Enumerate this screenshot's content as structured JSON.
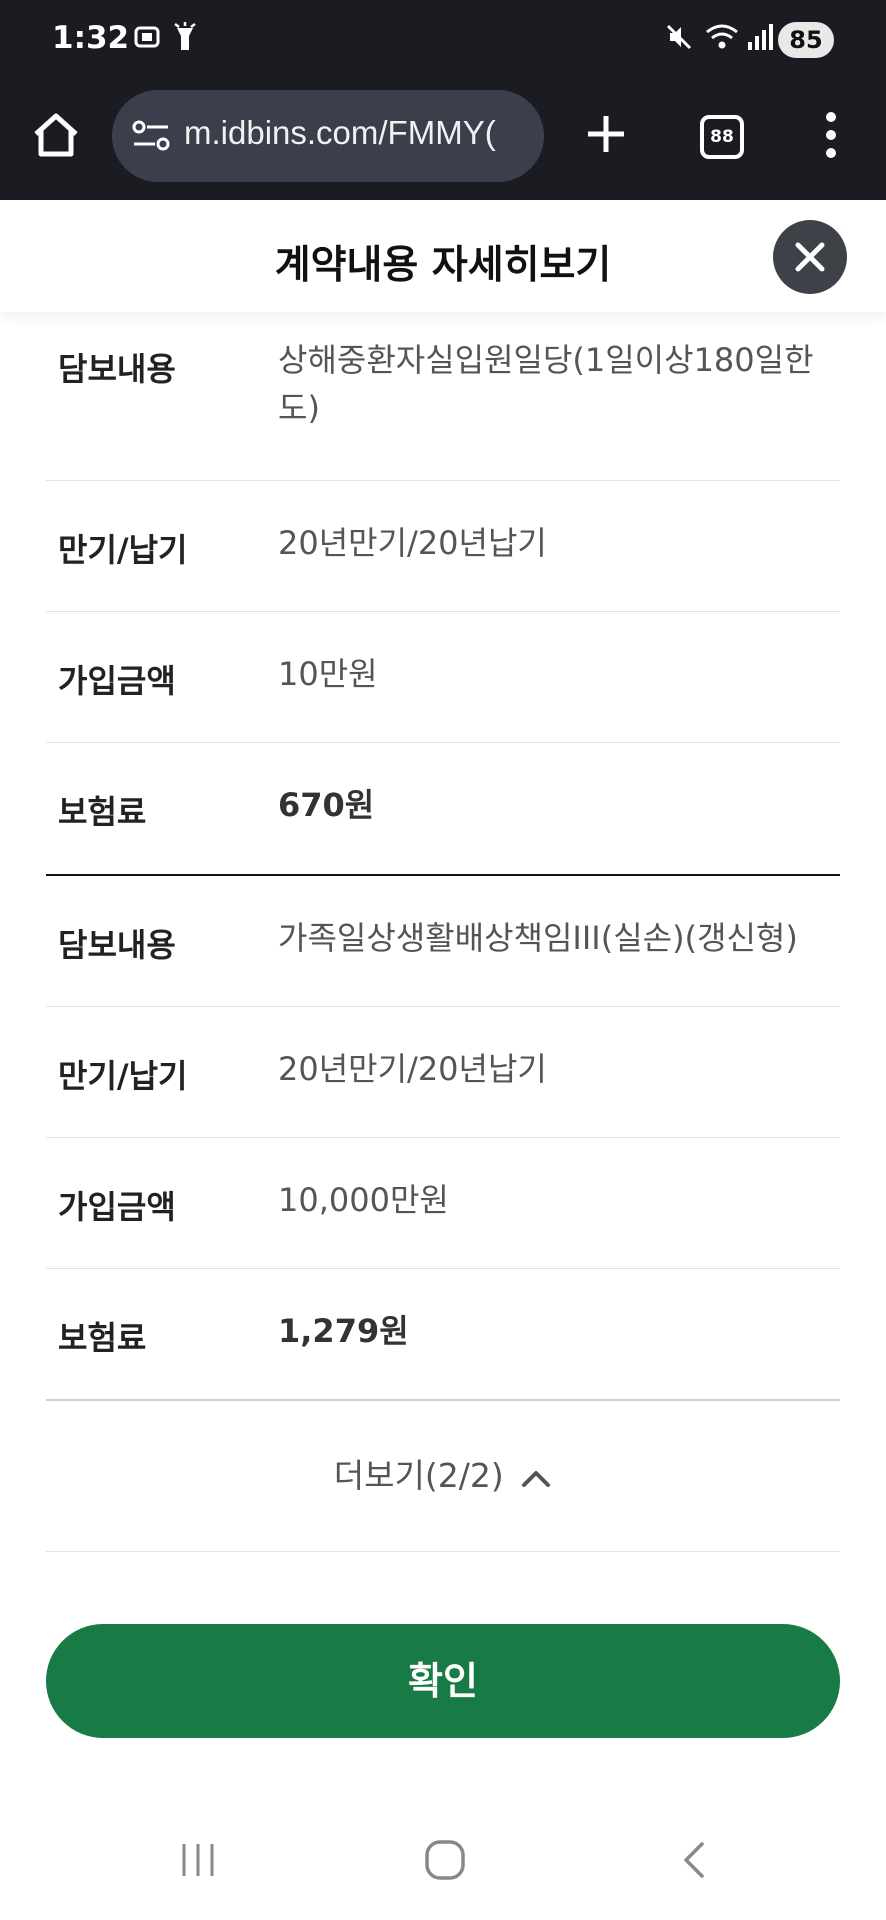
{
  "status_bar": {
    "time": "1:32",
    "battery": "85",
    "icons": [
      "screenshot-icon",
      "flashlight-icon",
      "mute-icon",
      "wifi-icon",
      "signal-icon"
    ]
  },
  "browser": {
    "url": "m.idbins.com/FMMY(",
    "tab_count": "88",
    "icons": [
      "home-icon",
      "site-info-icon",
      "new-tab-icon",
      "tab-switcher-icon",
      "more-menu-icon"
    ]
  },
  "sheet": {
    "title": "계약내용 자세히보기",
    "close_icon": "close-icon"
  },
  "coverages": [
    {
      "rows": [
        {
          "label": "담보내용",
          "value": "상해중환자실입원일당(1일이상180일한도)",
          "bold": false
        },
        {
          "label": "만기/납기",
          "value": "20년만기/20년납기",
          "bold": false
        },
        {
          "label": "가입금액",
          "value": "10만원",
          "bold": false
        },
        {
          "label": "보험료",
          "value": "670원",
          "bold": true
        }
      ]
    },
    {
      "rows": [
        {
          "label": "담보내용",
          "value": "가족일상생활배상책임III(실손)(갱신형)",
          "bold": false
        },
        {
          "label": "만기/납기",
          "value": "20년만기/20년납기",
          "bold": false
        },
        {
          "label": "가입금액",
          "value": "10,000만원",
          "bold": false
        },
        {
          "label": "보험료",
          "value": "1,279원",
          "bold": true
        }
      ]
    }
  ],
  "more": {
    "label": "더보기(2/2)",
    "icon": "chevron-up-icon"
  },
  "confirm_label": "확인",
  "nav_bar": {
    "icons": [
      "recent-apps-icon",
      "home-nav-icon",
      "back-icon"
    ]
  },
  "colors": {
    "confirm_bg": "#187a44",
    "chrome_bg": "#1a1c22",
    "url_box_bg": "#3a3f4b",
    "close_bg": "#3e4248"
  }
}
